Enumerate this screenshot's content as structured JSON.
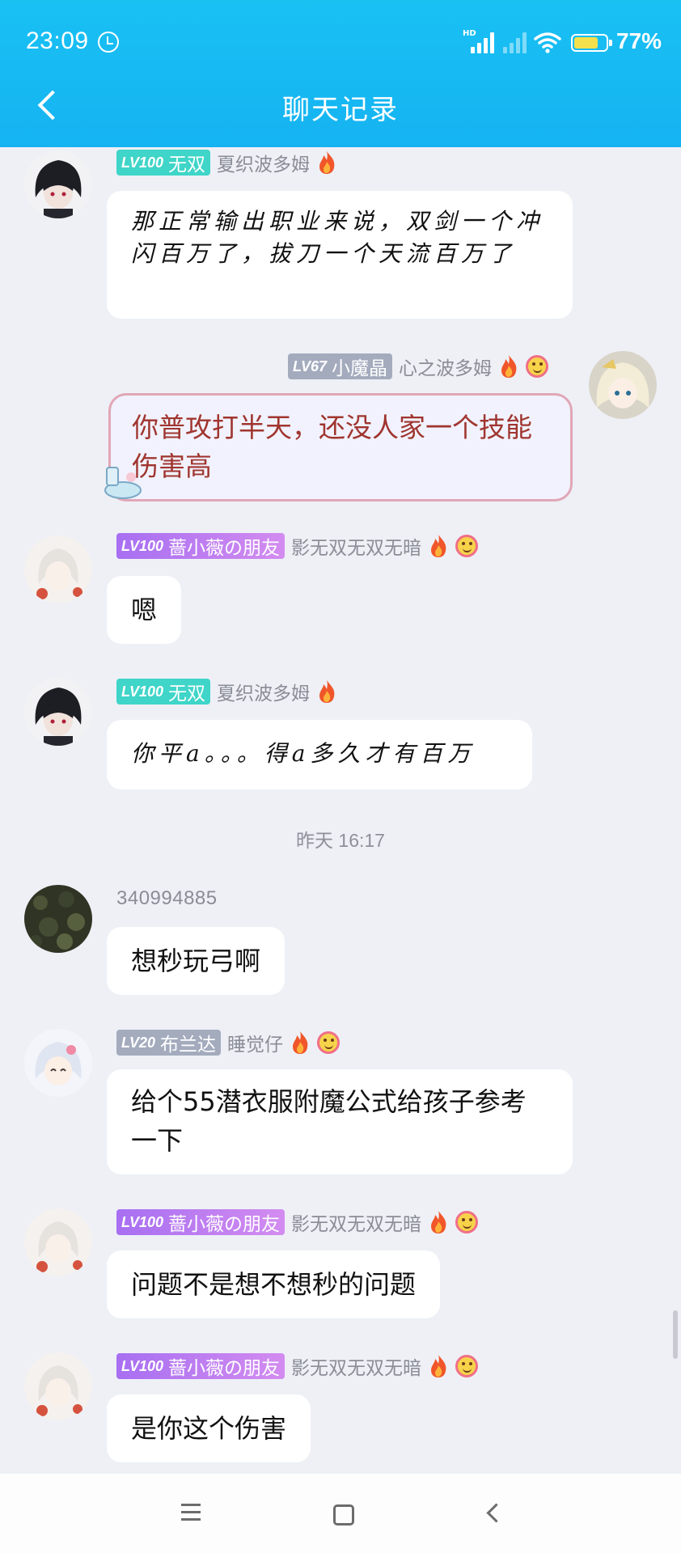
{
  "status_bar": {
    "time": "23:09",
    "network_badge": "HD",
    "battery_percent": "77%",
    "battery_level": 0.77
  },
  "header": {
    "title": "聊天记录"
  },
  "messages": [
    {
      "level": "LV100",
      "tag": "无双",
      "tag_color": "#3fd5c8",
      "nickname": "夏织波多姆",
      "badges": [
        "fire-icon"
      ],
      "text": "那正常输出职业来说，双剑一个冲闪百万了，拔刀一个天流百万了",
      "style": "handwriting"
    },
    {
      "level": "LV67",
      "tag": "小魔晶",
      "tag_color": "#a3abbd",
      "nickname": "心之波多姆",
      "badges": [
        "fire-icon",
        "smile-icon"
      ],
      "from_self": true,
      "text": "你普攻打半天，还没人家一个技能伤害高",
      "style": "decorated"
    },
    {
      "level": "LV100",
      "tag": "蔷小薇の朋友",
      "tag_color": "#b77cf1",
      "nickname": "影无双无双无暗",
      "badges": [
        "fire-icon",
        "smile-icon"
      ],
      "text": "嗯"
    },
    {
      "level": "LV100",
      "tag": "无双",
      "tag_color": "#3fd5c8",
      "nickname": "夏织波多姆",
      "badges": [
        "fire-icon"
      ],
      "text": "你平a。。。得a多久才有百万",
      "style": "handwriting"
    }
  ],
  "timestamp": "昨天 16:17",
  "messages_after": [
    {
      "nickname": "340994885",
      "text": "想秒玩弓啊"
    },
    {
      "level": "LV20",
      "tag": "布兰达",
      "tag_color": "#a3abbd",
      "nickname": "睡觉仔",
      "badges": [
        "fire-icon",
        "smile-icon"
      ],
      "text": "给个55潜衣服附魔公式给孩子参考一下"
    },
    {
      "level": "LV100",
      "tag": "蔷小薇の朋友",
      "tag_color": "#b77cf1",
      "nickname": "影无双无双无暗",
      "badges": [
        "fire-icon",
        "smile-icon"
      ],
      "text": "问题不是想不想秒的问题"
    },
    {
      "level": "LV100",
      "tag": "蔷小薇の朋友",
      "tag_color": "#b77cf1",
      "nickname": "影无双无双无暗",
      "badges": [
        "fire-icon",
        "smile-icon"
      ],
      "text": "是你这个伤害"
    }
  ],
  "colors": {
    "header": "#15b3f2",
    "background": "#eef0f6",
    "bubble": "#ffffff"
  }
}
